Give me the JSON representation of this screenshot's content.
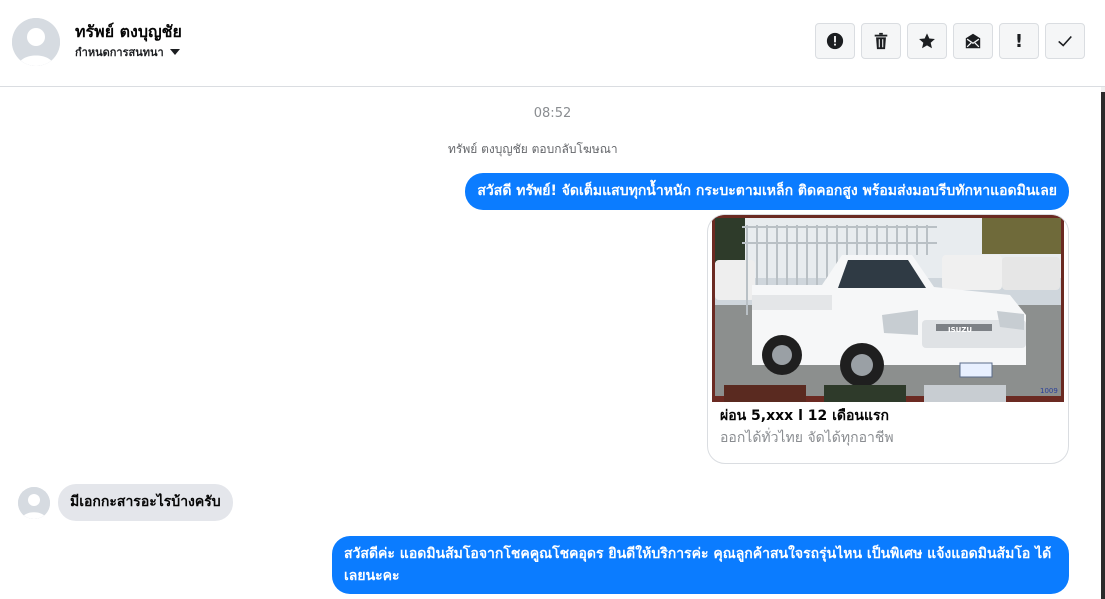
{
  "header": {
    "contact_name": "ทรัพย์ ตงบุญชัย",
    "assign_label": "กำหนดการสนทนา",
    "actions": [
      {
        "name": "report-icon",
        "label": "Report"
      },
      {
        "name": "trash-icon",
        "label": "Delete"
      },
      {
        "name": "star-icon",
        "label": "Star"
      },
      {
        "name": "mark-unread-icon",
        "label": "Mark as unread"
      },
      {
        "name": "follow-up-icon",
        "label": "!"
      },
      {
        "name": "checkmark-icon",
        "label": "Done"
      }
    ]
  },
  "thread": {
    "timestamp": "08:52",
    "ad_reply_note": "ทรัพย์ ตงบุญชัย ตอบกลับโฆษณา",
    "messages": [
      {
        "direction": "outgoing",
        "text": "สวัสดี ทรัพย์! จัดเต็มแสบทุกน้ำหนัก กระบะตามเหล็ก ติดคอกสูง พร้อมส่งมอบรีบทักหาแอดมินเลย"
      },
      {
        "direction": "incoming",
        "text": "มีเอกกะสารอะไรบ้างครับ"
      },
      {
        "direction": "outgoing",
        "text": "สวัสดีค่ะ แอดมินส้มโอจากโชคคูณโชคอุดร ยินดีให้บริการค่ะ   คุณลูกค้าสนใจรถรุ่นไหน เป็นพิเศษ แจ้งแอดมินส้มโอ ได้เลยนะคะ"
      }
    ],
    "ad_card": {
      "title": "ผ่อน 5,xxx l 12 เดือนแรก",
      "description": "ออกได้ทั่วไทย จัดได้ทุกอาชีพ",
      "image_alt": "white Isuzu pickup truck with steel cage",
      "plate_text": "1009",
      "brand_badge": "ISUZU"
    }
  },
  "colors": {
    "accent": "#0b7cff",
    "incoming_bubble": "#e4e6eb",
    "muted_text": "#8a8d91"
  }
}
